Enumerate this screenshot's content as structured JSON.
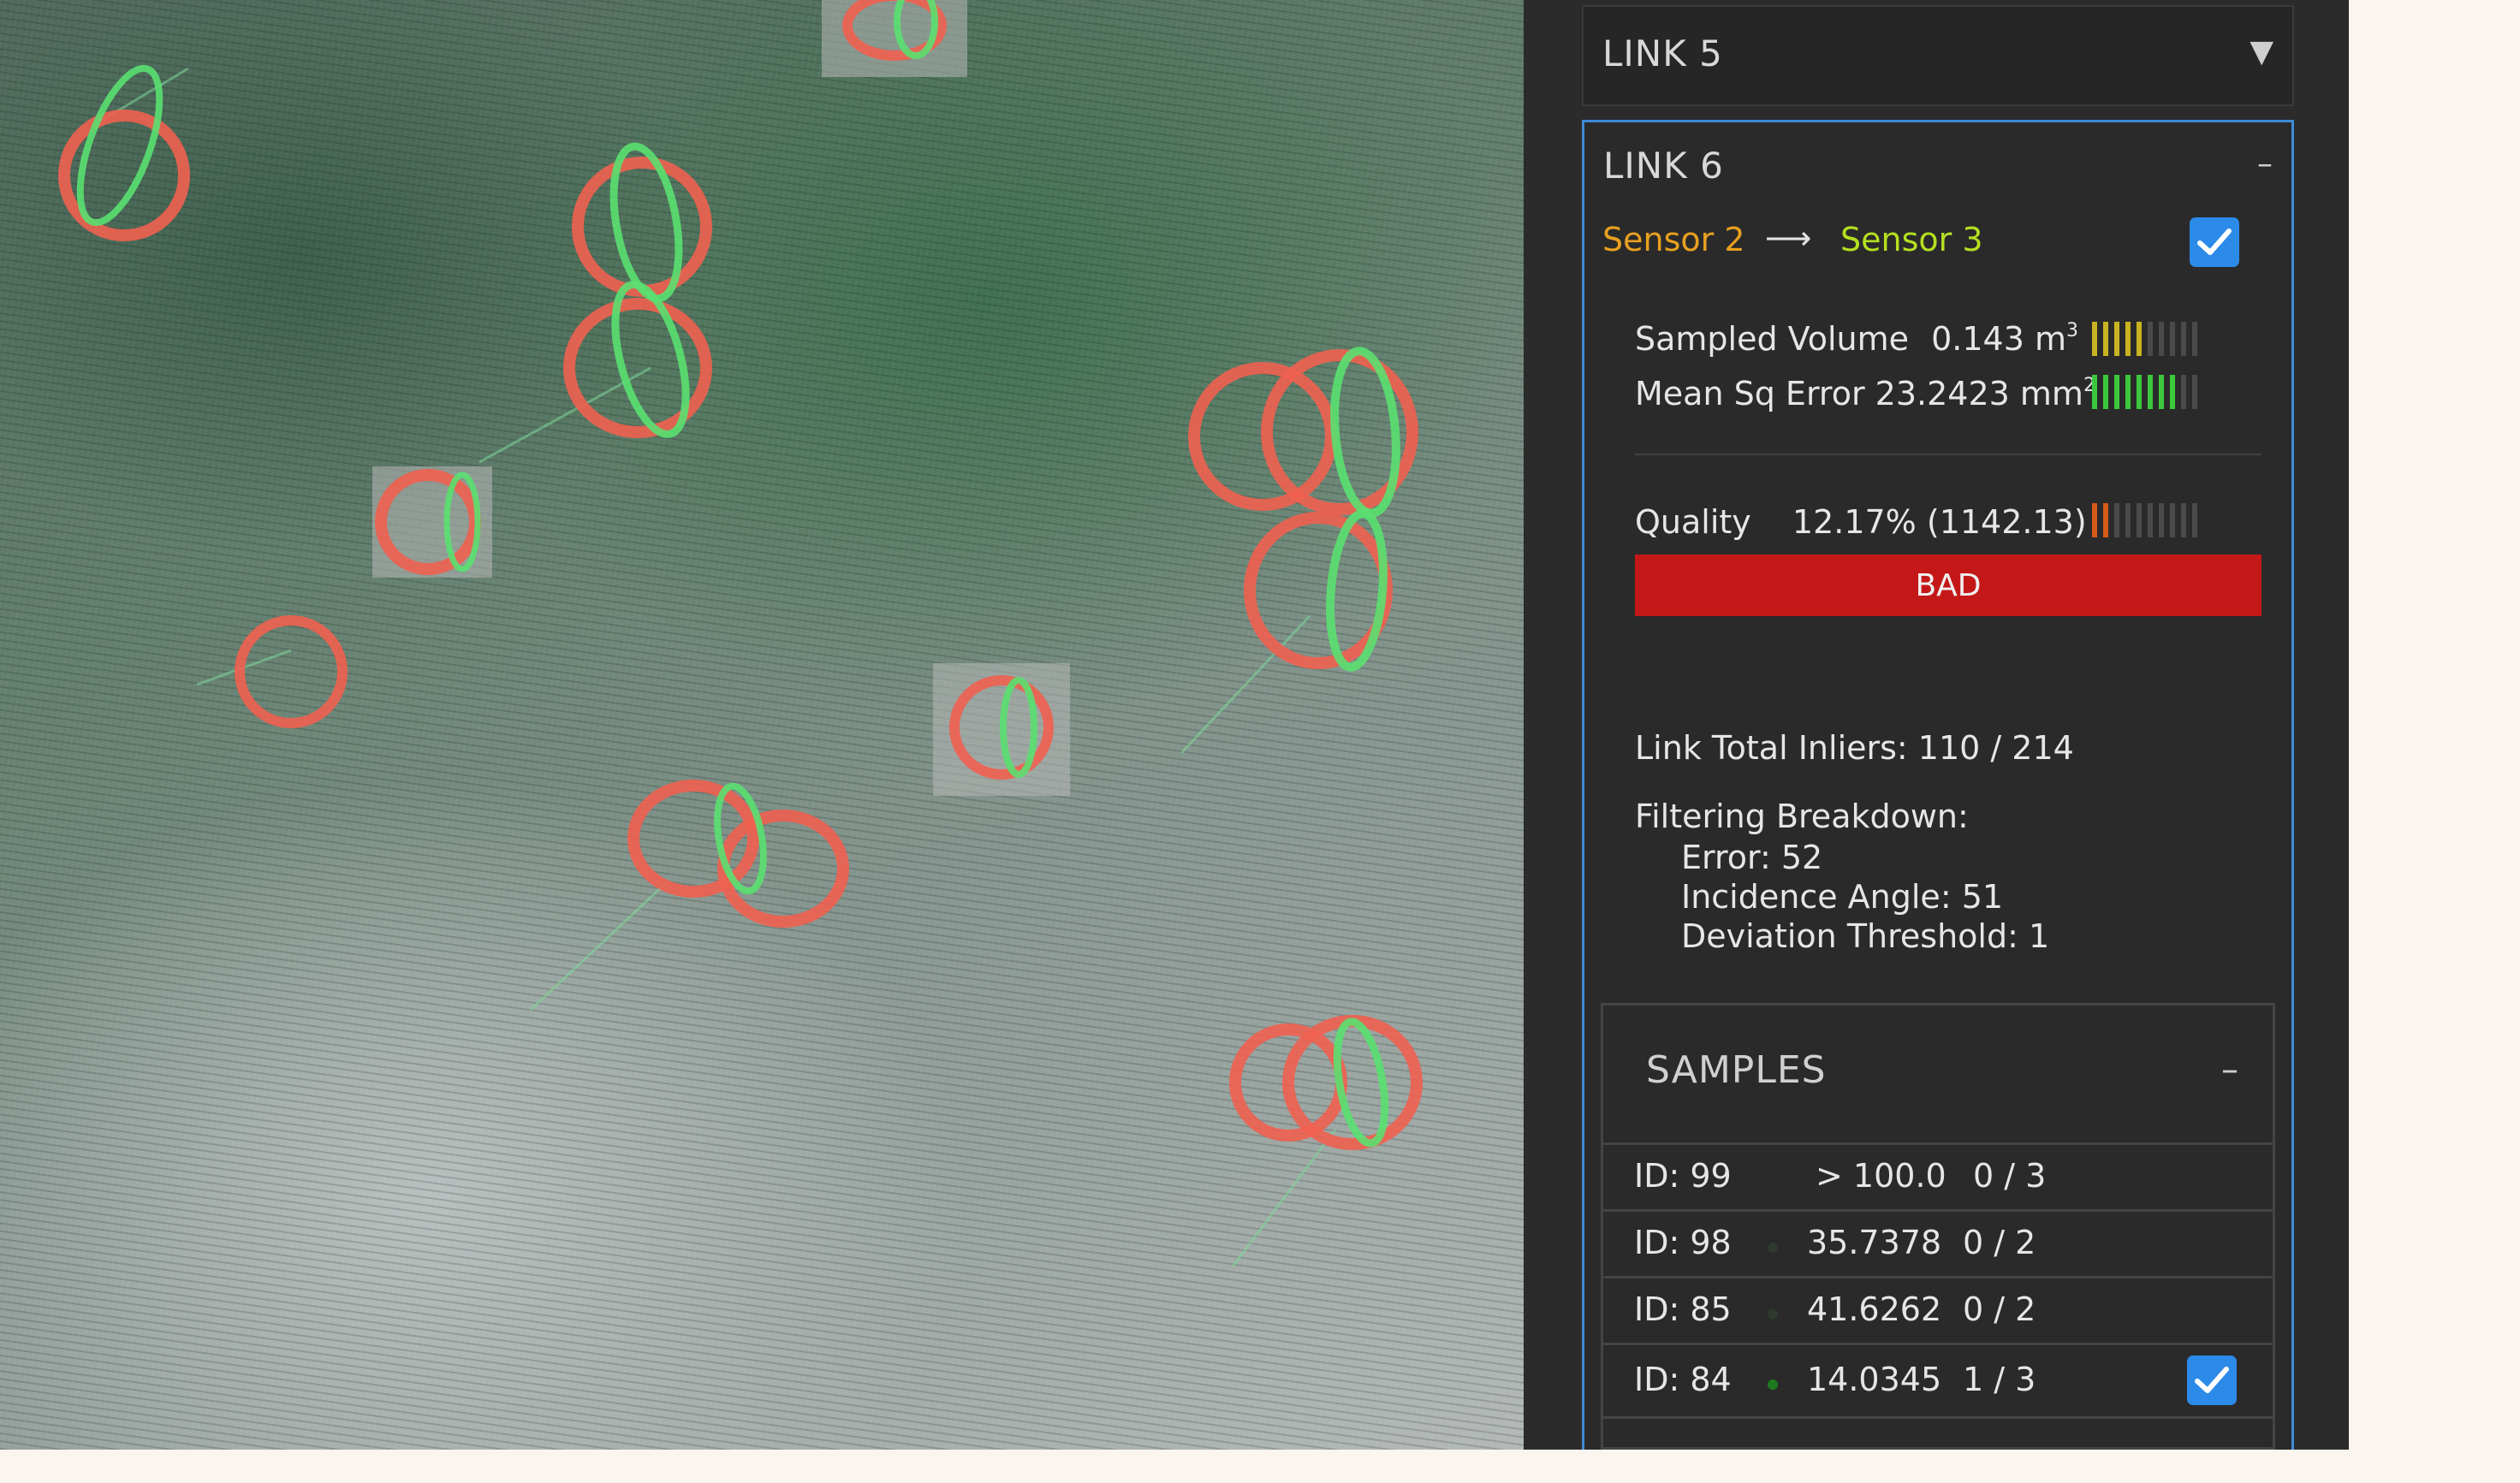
{
  "link5": {
    "title": "LINK 5",
    "expand_symbol": "▼"
  },
  "link6": {
    "title": "LINK 6",
    "collapse_symbol": "–",
    "sensor_from": "Sensor 2",
    "arrow": "⟶",
    "sensor_to": "Sensor 3",
    "enabled": true,
    "sampled_volume": {
      "label": "Sampled Volume",
      "value": "0.143",
      "unit": "m",
      "exp": "3",
      "meter_level": 5,
      "meter_total": 10,
      "meter_color": "#c8b422"
    },
    "mean_sq_error": {
      "label": "Mean Sq Error",
      "value": "23.2423",
      "unit": "mm",
      "exp": "2",
      "meter_level": 8,
      "meter_total": 10,
      "meter_color": "#3cc83c"
    },
    "quality": {
      "label": "Quality",
      "value": "12.17% (1142.13)",
      "meter_level": 2,
      "meter_total": 10,
      "meter_color": "#d65a18"
    },
    "status": "BAD",
    "status_color": "#c41818",
    "link_total_inliers": "Link Total Inliers: 110 / 214",
    "filtering_breakdown": {
      "heading": "Filtering Breakdown:",
      "lines": [
        "Error: 52",
        "Incidence Angle: 51",
        "Deviation Threshold: 1"
      ]
    }
  },
  "samples": {
    "title": "SAMPLES",
    "collapse_symbol": "–",
    "rows": [
      {
        "id": "ID: 99",
        "score": "> 100.0",
        "count": "0 / 3",
        "dot_color": "",
        "checked": false
      },
      {
        "id": "ID: 98",
        "score": "35.7378",
        "count": "0 / 2",
        "dot_color": "#2e3a2e",
        "checked": false
      },
      {
        "id": "ID: 85",
        "score": "41.6262",
        "count": "0 / 2",
        "dot_color": "#2e3a2e",
        "checked": false
      },
      {
        "id": "ID: 84",
        "score": "14.0345",
        "count": "1 / 3",
        "dot_color": "#1f7a1f",
        "checked": true
      }
    ]
  },
  "colors": {
    "accent_blue": "#3f8bd6",
    "sensor_from": "#e8a020",
    "sensor_to": "#b4e020",
    "checkbox": "#2c8ae8"
  }
}
